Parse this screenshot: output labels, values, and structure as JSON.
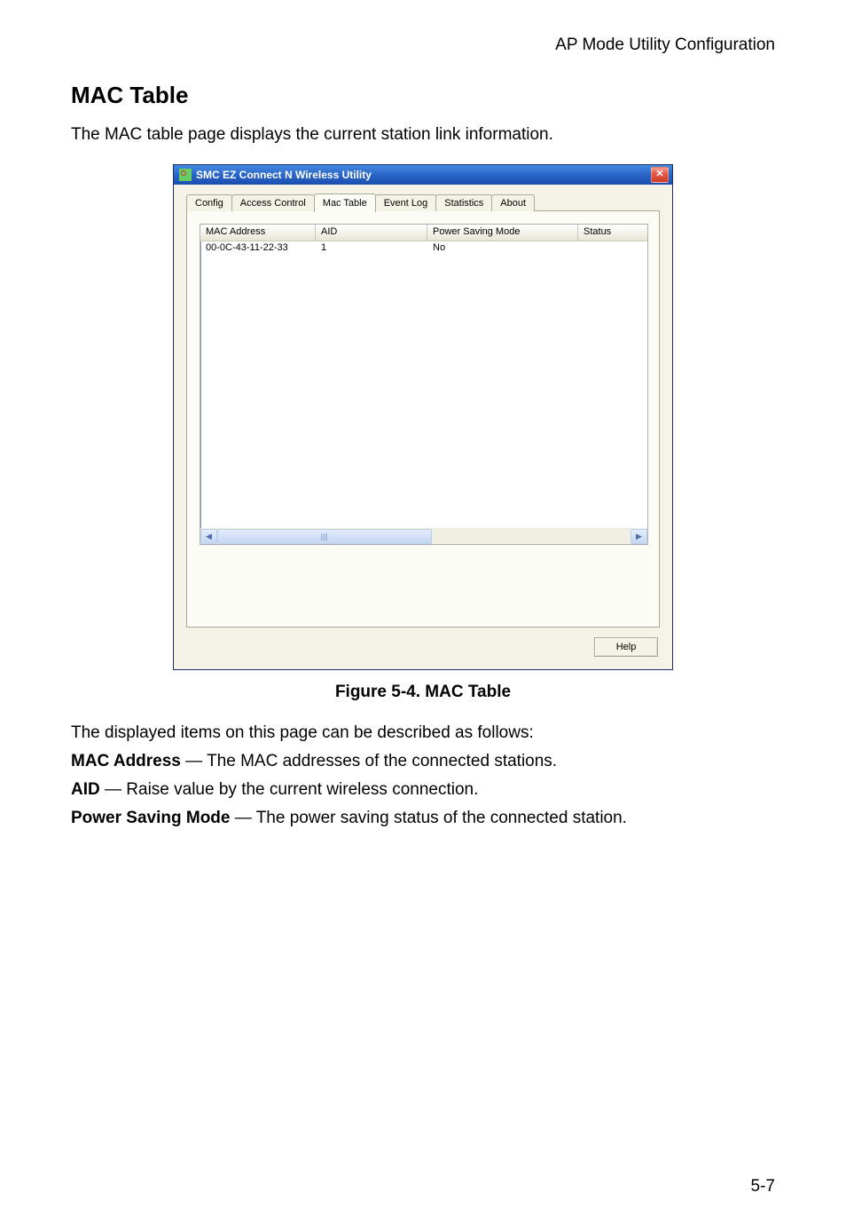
{
  "header_right": "AP Mode Utility Configuration",
  "section_title": "MAC Table",
  "intro_text": "The MAC table page displays the current station link information.",
  "window": {
    "title": "SMC EZ Connect N Wireless Utility",
    "close_glyph": "✕",
    "tabs": [
      "Config",
      "Access Control",
      "Mac Table",
      "Event Log",
      "Statistics",
      "About"
    ],
    "active_tab_index": 2,
    "columns": [
      "MAC Address",
      "AID",
      "Power Saving Mode",
      "Status"
    ],
    "rows": [
      {
        "mac": "00-0C-43-11-22-33",
        "aid": "1",
        "psm": "No",
        "status": ""
      }
    ],
    "scroll_left_glyph": "◀",
    "scroll_right_glyph": "▶",
    "help_label": "Help"
  },
  "figure_caption": "Figure 5-4.  MAC Table",
  "desc_intro": "The displayed items on this page can be described as follows:",
  "desc_items": [
    {
      "term": "MAC Address",
      "rest": " — The MAC addresses of the connected stations."
    },
    {
      "term": "AID",
      "rest": " — Raise value by the current wireless connection."
    },
    {
      "term": "Power Saving Mode",
      "rest": " — The power saving status of the connected station."
    }
  ],
  "page_number": "5-7"
}
